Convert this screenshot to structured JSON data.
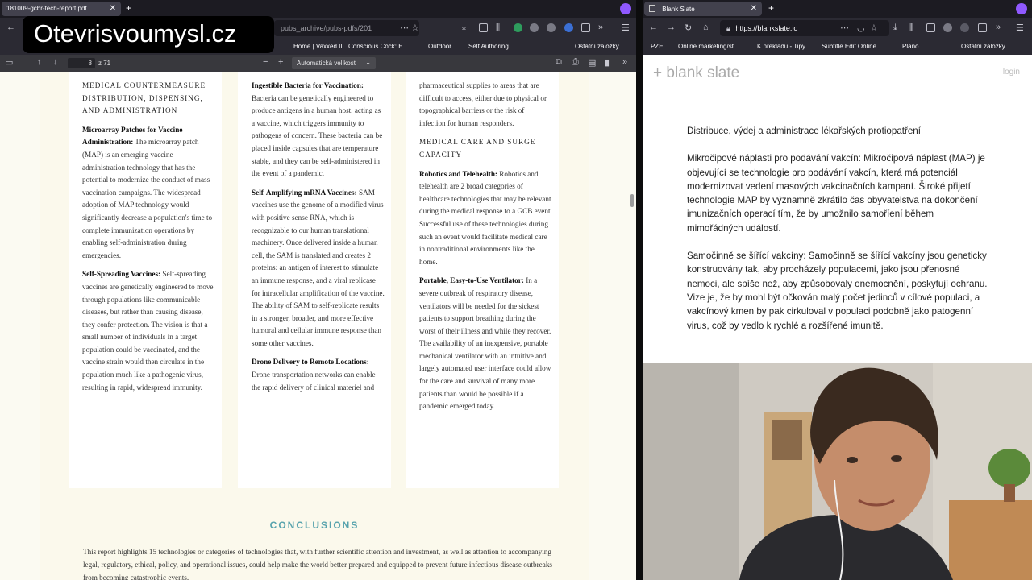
{
  "left": {
    "tab": {
      "title": "181009-gcbr-tech-report.pdf"
    },
    "nav": {
      "url": "pubs_archive/pubs-pdfs/201"
    },
    "bookmarks": [
      "Home | Vaxxed II",
      "Conscious Cock: E...",
      "Outdoor",
      "Self Authoring",
      "Ostatní záložky"
    ],
    "pdf_toolbar": {
      "page_current": "8",
      "page_total": "z 71",
      "zoom": "Automatická velikost"
    },
    "col1": {
      "title": "MEDICAL COUNTERMEASURE DISTRIBUTION, DISPENSING, AND ADMINISTRATION",
      "paras": [
        {
          "head": "Microarray Patches for Vaccine Administration:",
          "body": " The microarray patch (MAP) is an emerging vaccine administration technology that has the potential to modernize the conduct of mass vaccination campaigns. The widespread adoption of MAP technology would significantly decrease a population's time to complete immunization operations by enabling self-administration during emergencies."
        },
        {
          "head": "Self-Spreading Vaccines:",
          "body": " Self-spreading vaccines are genetically engineered to move through populations like communicable diseases, but rather than causing disease, they confer protection. The vision is that a small number of individuals in a target population could be vaccinated, and the vaccine strain would then circulate in the population much like a pathogenic virus, resulting in rapid, widespread immunity."
        }
      ]
    },
    "col2": {
      "paras": [
        {
          "head": "Ingestible Bacteria for Vaccination:",
          "body": " Bacteria can be genetically engineered to produce antigens in a human host, acting as a vaccine, which triggers immunity to pathogens of concern. These bacteria can be placed inside capsules that are temperature stable, and they can be self-administered in the event of a pandemic."
        },
        {
          "head": "Self-Amplifying mRNA Vaccines:",
          "body": " SAM vaccines use the genome of a modified virus with positive sense RNA, which is recognizable to our human translational machinery. Once delivered inside a human cell, the SAM is translated and creates 2 proteins: an antigen of interest to stimulate an immune response, and a viral replicase for intracellular amplification of the vaccine. The ability of SAM to self-replicate results in a stronger, broader, and more effective humoral and cellular immune response than some other vaccines."
        },
        {
          "head": "Drone Delivery to Remote Locations:",
          "body": " Drone transportation networks can enable the rapid delivery of clinical materiel and"
        }
      ]
    },
    "col3": {
      "lead": "pharmaceutical supplies to areas that are difficult to access, either due to physical or topographical barriers or the risk of infection for human responders.",
      "title": "MEDICAL CARE AND SURGE CAPACITY",
      "paras": [
        {
          "head": "Robotics and Telehealth:",
          "body": " Robotics and telehealth are 2 broad categories of healthcare technologies that may be relevant during the medical response to a GCB event. Successful use of these technologies during such an event would facilitate medical care in nontraditional environments like the home."
        },
        {
          "head": "Portable, Easy-to-Use Ventilator:",
          "body": " In a severe outbreak of respiratory disease, ventilators will be needed for the sickest patients to support breathing during the worst of their illness and while they recover. The availability of an inexpensive, portable mechanical ventilator with an intuitive and largely automated user interface could allow for the care and survival of many more patients than would be possible if a pandemic emerged today."
        }
      ]
    },
    "conclusions": {
      "title": "CONCLUSIONS",
      "text": "This report highlights 15 technologies or categories of technologies that, with further scientific attention and investment, as well as attention to accompanying legal, regulatory, ethical, policy, and operational issues, could help make the world better prepared and equipped to prevent future infectious disease outbreaks from becoming catastrophic events."
    }
  },
  "right": {
    "tab": {
      "title": "Blank Slate"
    },
    "nav": {
      "url": "https://blankslate.io"
    },
    "bookmarks": [
      "PZE",
      "Online marketing/st...",
      "K překladu - Tipy",
      "Subtitle Edit Online",
      "Plano",
      "Ostatní záložky"
    ],
    "app": {
      "logo": "+ blank slate",
      "login": "login"
    },
    "paragraphs": [
      "Distribuce, výdej a administrace lékařských protiopatření",
      "Mikročipové náplasti pro podávání vakcín: Mikročipová náplast (MAP) je objevující se technologie pro podávání vakcín, která má potenciál modernizovat vedení masových vakcinačních kampaní. Široké přijetí technologie MAP by významně zkrátilo čas obyvatelstva na dokončení imunizačních operací tím, že by umožnilo samoříení během mimořádných událostí.",
      "Samočinně se šířící vakcíny: Samočinně se šířící vakcíny jsou geneticky konstruovány tak, aby procházely populacemi, jako jsou přenosné nemoci, ale spíše než, aby způsobovaly onemocnění, poskytují ochranu. Vize je, že by mohl být očkován malý počet jedinců v cílové populaci, a vakcínový kmen by pak cirkuloval v populaci podobně jako patogenní virus, což by vedlo k rychlé a rozšířené imunitě."
    ]
  },
  "watermark": "Otevrisvoumysl.cz"
}
